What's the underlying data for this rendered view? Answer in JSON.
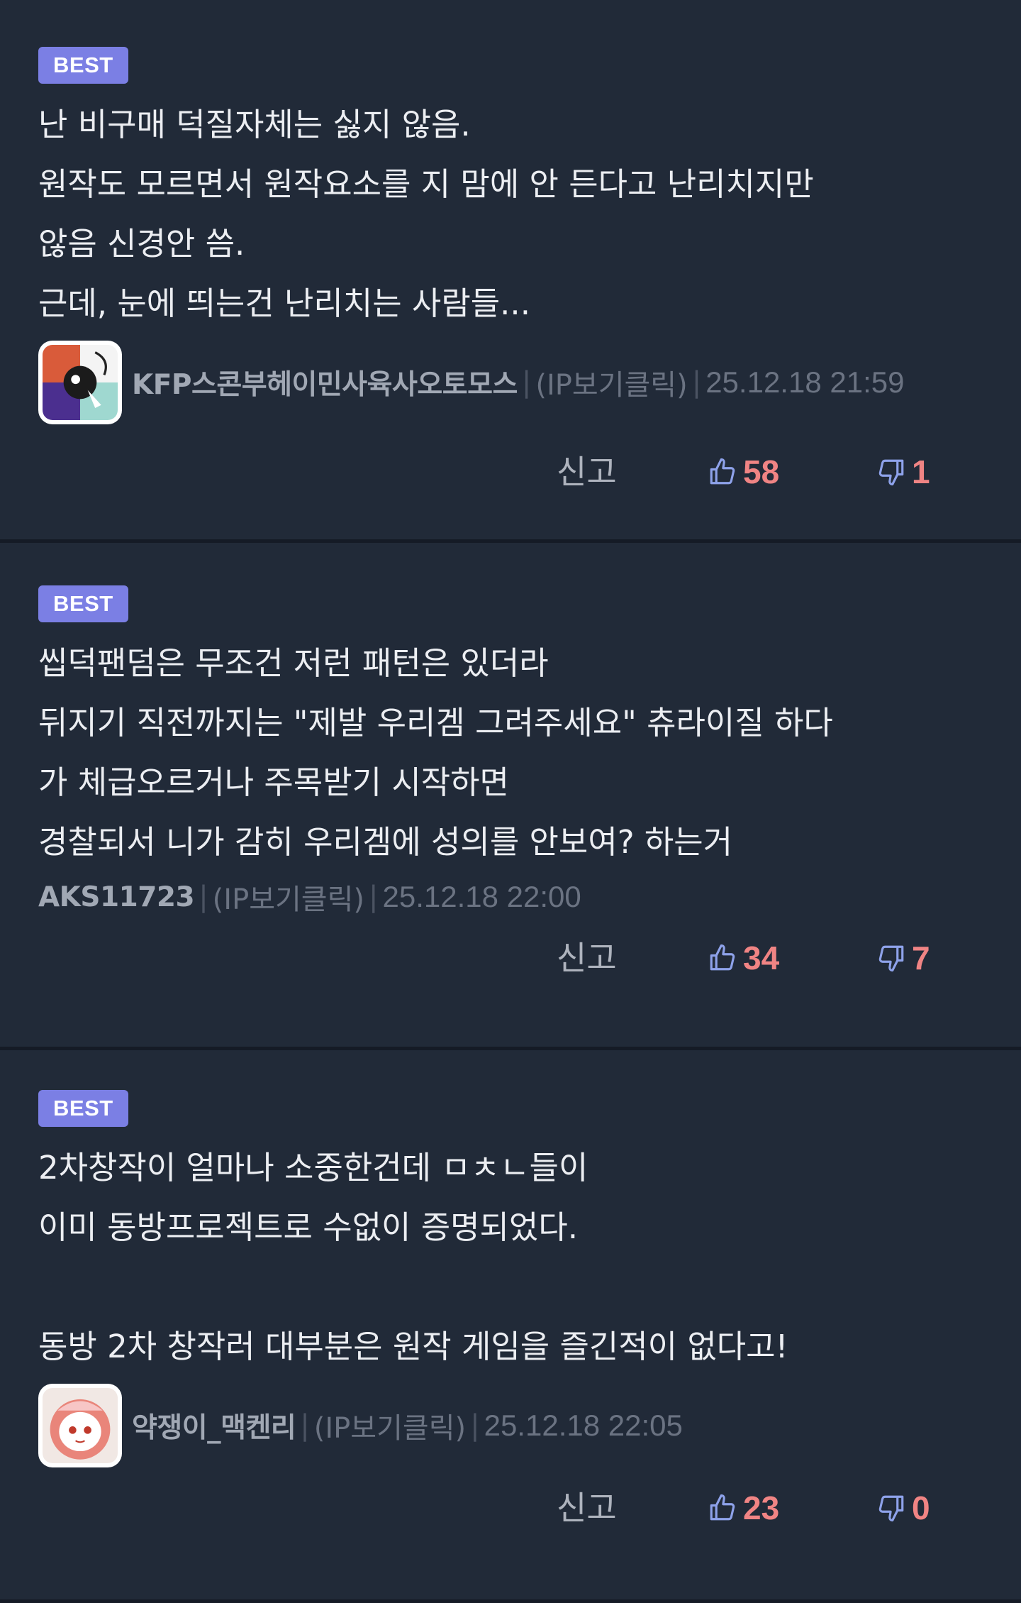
{
  "comments": [
    {
      "badge": "BEST",
      "text": "난 비구매 덕질자체는 싫지 않음.\n원작도 모르면서 원작요소를 지 맘에 안 든다고 난리치지만\n않음 신경안 씀.\n근데, 눈에 띄는건 난리치는 사람들...",
      "has_avatar": true,
      "author": "KFP스콘부헤이민사육사오토모스",
      "ip": "(IP보기클릭)",
      "date": "25.12.18 21:59",
      "report": "신고",
      "likes": "58",
      "dislikes": "1"
    },
    {
      "badge": "BEST",
      "text": "씹덕팬덤은 무조건 저런 패턴은 있더라\n뒤지기 직전까지는 \"제발 우리겜 그려주세요\" 츄라이질 하다\n가 체급오르거나 주목받기 시작하면\n경찰되서 니가 감히 우리겜에 성의를 안보여? 하는거",
      "has_avatar": false,
      "author": "AKS11723",
      "ip": "(IP보기클릭)",
      "date": "25.12.18 22:00",
      "report": "신고",
      "likes": "34",
      "dislikes": "7"
    },
    {
      "badge": "BEST",
      "text": "2차창작이 얼마나 소중한건데 ㅁㅊㄴ들이\n이미 동방프로젝트로 수없이 증명되었다.\n\n동방 2차 창작러 대부분은 원작 게임을 즐긴적이 없다고!",
      "has_avatar": true,
      "author": "약쟁이_맥켄리",
      "ip": "(IP보기클릭)",
      "date": "25.12.18 22:05",
      "report": "신고",
      "likes": "23",
      "dislikes": "0"
    }
  ],
  "icons": {
    "like": "thumbs-up-icon",
    "dislike": "thumbs-down-icon"
  },
  "colors": {
    "background": "#212a38",
    "badge": "#7b7fe4",
    "vote_count": "#f08484",
    "icon": "#8ea2ea"
  }
}
